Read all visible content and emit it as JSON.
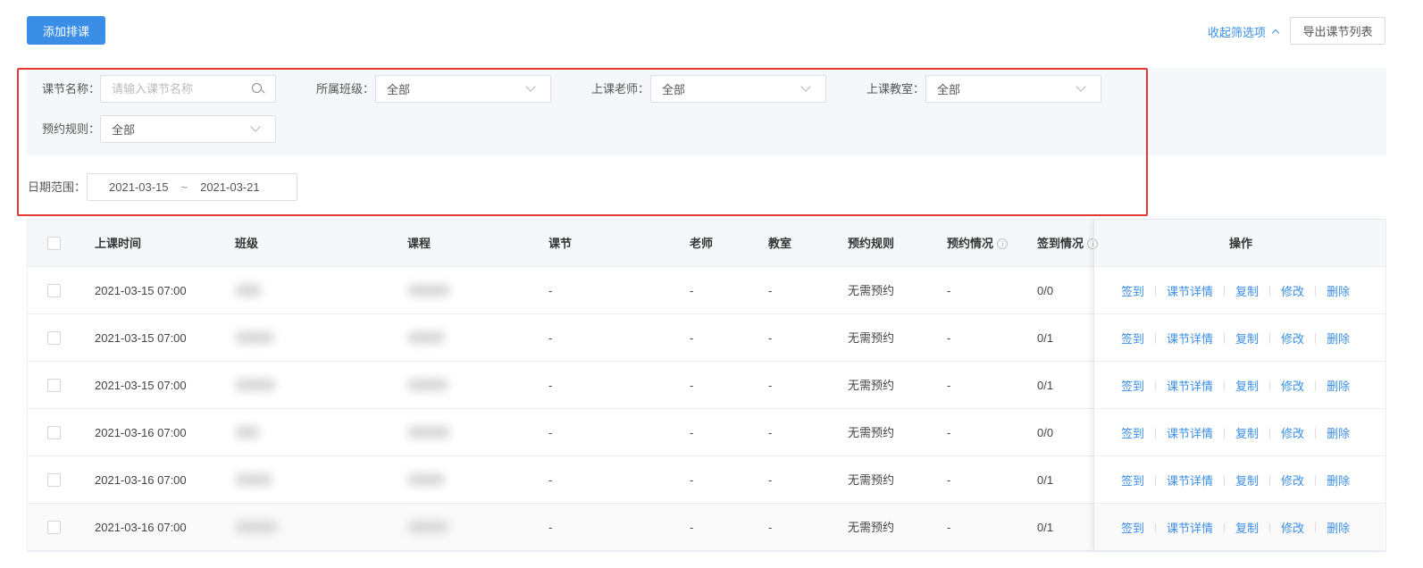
{
  "toolbar": {
    "add_label": "添加排课",
    "collapse_label": "收起筛选项",
    "export_label": "导出课节列表"
  },
  "filters": {
    "lesson_name": {
      "label": "课节名称：",
      "placeholder": "请输入课节名称"
    },
    "class": {
      "label": "所属班级：",
      "value": "全部"
    },
    "teacher": {
      "label": "上课老师：",
      "value": "全部"
    },
    "classroom": {
      "label": "上课教室：",
      "value": "全部"
    },
    "booking_rule": {
      "label": "预约规则：",
      "value": "全部"
    },
    "date_range": {
      "label": "日期范围：",
      "start": "2021-03-15",
      "separator": "~",
      "end": "2021-03-21"
    }
  },
  "table": {
    "columns": {
      "time": "上课时间",
      "class": "班级",
      "course": "课程",
      "lesson": "课节",
      "teacher": "老师",
      "classroom": "教室",
      "rule": "预约规则",
      "booking": "预约情况",
      "checkin": "签到情况",
      "ops": "操作"
    },
    "actions": {
      "checkin": "签到",
      "detail": "课节详情",
      "copy": "复制",
      "edit": "修改",
      "delete": "删除"
    },
    "rows": [
      {
        "time": "2021-03-15 07:00",
        "lesson": "-",
        "teacher": "-",
        "classroom": "-",
        "rule": "无需预约",
        "booking": "-",
        "checkin": "0/0"
      },
      {
        "time": "2021-03-15 07:00",
        "lesson": "-",
        "teacher": "-",
        "classroom": "-",
        "rule": "无需预约",
        "booking": "-",
        "checkin": "0/1"
      },
      {
        "time": "2021-03-15 07:00",
        "lesson": "-",
        "teacher": "-",
        "classroom": "-",
        "rule": "无需预约",
        "booking": "-",
        "checkin": "0/1"
      },
      {
        "time": "2021-03-16 07:00",
        "lesson": "-",
        "teacher": "-",
        "classroom": "-",
        "rule": "无需预约",
        "booking": "-",
        "checkin": "0/0"
      },
      {
        "time": "2021-03-16 07:00",
        "lesson": "-",
        "teacher": "-",
        "classroom": "-",
        "rule": "无需预约",
        "booking": "-",
        "checkin": "0/1"
      },
      {
        "time": "2021-03-16 07:00",
        "lesson": "-",
        "teacher": "-",
        "classroom": "-",
        "rule": "无需预约",
        "booking": "-",
        "checkin": "0/1"
      }
    ]
  },
  "colors": {
    "accent": "#3a8ee6",
    "highlight_border": "#e53935"
  }
}
